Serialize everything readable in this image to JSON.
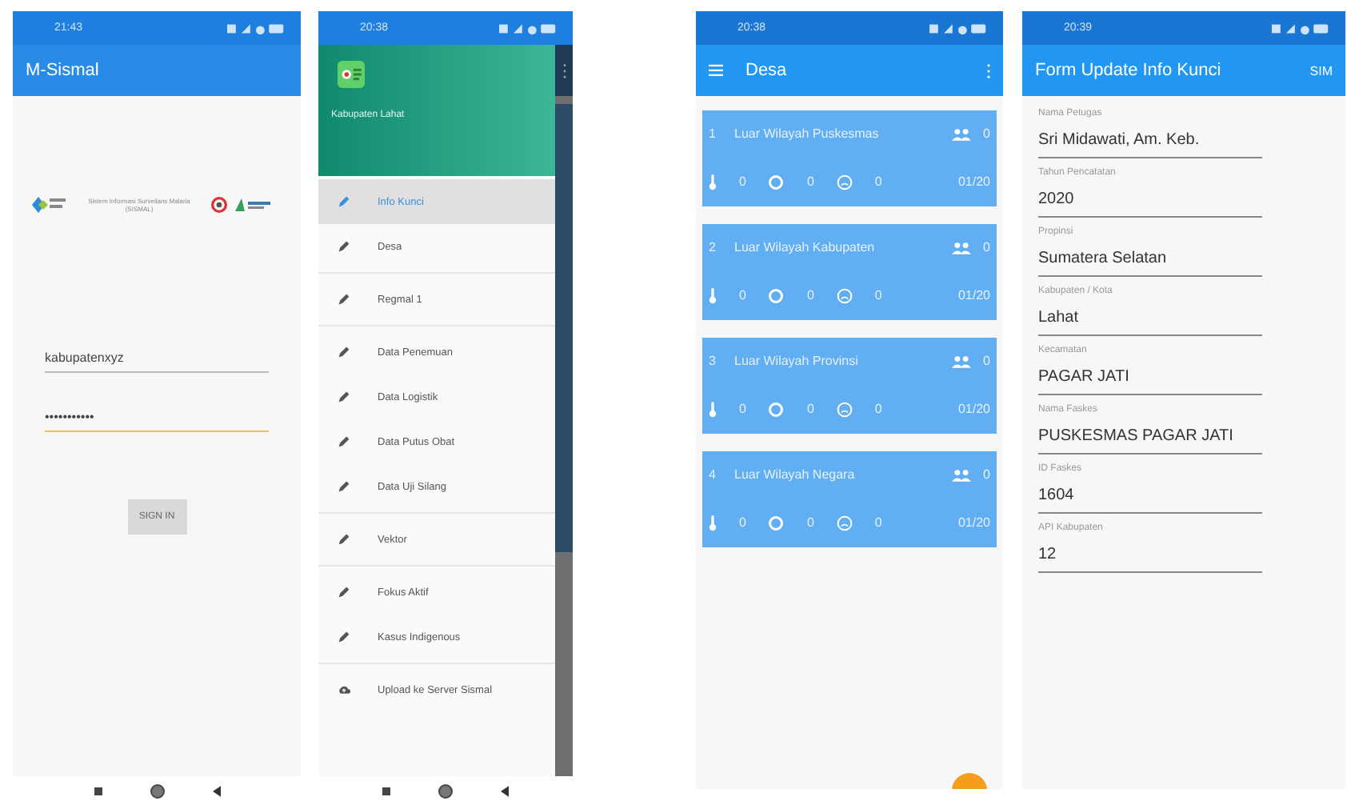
{
  "login_screen": {
    "status_time": "21:43",
    "app_title": "M-Sismal",
    "logo_caption": "Sistem Informasi Surveilans Malaria (SISMAL)",
    "fields": [
      {
        "value": "kabupatenxyz",
        "focused": false
      },
      {
        "value": "•••••••••••",
        "focused": true
      }
    ],
    "sign_in_button": "SIGN IN"
  },
  "drawer_screen": {
    "status_time": "20:38",
    "header_label": "Kabupaten Lahat",
    "groups": [
      [
        {
          "label": "Info Kunci",
          "kind": "edit",
          "selected": true
        },
        {
          "label": "Desa",
          "kind": "edit",
          "selected": false
        }
      ],
      [
        {
          "label": "Regmal 1",
          "kind": "edit",
          "selected": false
        }
      ],
      [
        {
          "label": "Data Penemuan",
          "kind": "edit",
          "selected": false
        },
        {
          "label": "Data Logistik",
          "kind": "edit",
          "selected": false
        },
        {
          "label": "Data Putus Obat",
          "kind": "edit",
          "selected": false
        },
        {
          "label": "Data Uji Silang",
          "kind": "edit",
          "selected": false
        }
      ],
      [
        {
          "label": "Vektor",
          "kind": "edit",
          "selected": false
        }
      ],
      [
        {
          "label": "Fokus Aktif",
          "kind": "edit",
          "selected": false
        },
        {
          "label": "Kasus Indigenous",
          "kind": "edit",
          "selected": false
        }
      ],
      [
        {
          "label": "Upload ke Server Sismal",
          "kind": "upload",
          "selected": false
        }
      ]
    ]
  },
  "desa_screen": {
    "status_time": "20:38",
    "app_title": "Desa",
    "cards": [
      {
        "number": "1",
        "name": "Luar Wilayah Puskesmas",
        "people": "0",
        "count_1": "0",
        "count_2": "0",
        "count_3": "0",
        "period": "01/20"
      },
      {
        "number": "2",
        "name": "Luar Wilayah Kabupaten",
        "people": "0",
        "count_1": "0",
        "count_2": "0",
        "count_3": "0",
        "period": "01/20"
      },
      {
        "number": "3",
        "name": "Luar Wilayah Provinsi",
        "people": "0",
        "count_1": "0",
        "count_2": "0",
        "count_3": "0",
        "period": "01/20"
      },
      {
        "number": "4",
        "name": "Luar Wilayah Negara",
        "people": "0",
        "count_1": "0",
        "count_2": "0",
        "count_3": "0",
        "period": "01/20"
      }
    ]
  },
  "form_screen": {
    "status_time": "20:39",
    "app_title": "Form Update Info Kunci",
    "action": "SIM",
    "fields": [
      {
        "label": "Nama Petugas",
        "value": "Sri Midawati, Am. Keb."
      },
      {
        "label": "Tahun Pencatatan",
        "value": "2020"
      },
      {
        "label": "Propinsi",
        "value": "Sumatera Selatan"
      },
      {
        "label": "Kabupaten / Kota",
        "value": "Lahat"
      },
      {
        "label": "Kecamatan",
        "value": "PAGAR JATI"
      },
      {
        "label": "Nama Faskes",
        "value": "PUSKESMAS PAGAR JATI"
      },
      {
        "label": "ID Faskes",
        "value": "1604"
      },
      {
        "label": "API Kabupaten",
        "value": "12"
      }
    ]
  }
}
